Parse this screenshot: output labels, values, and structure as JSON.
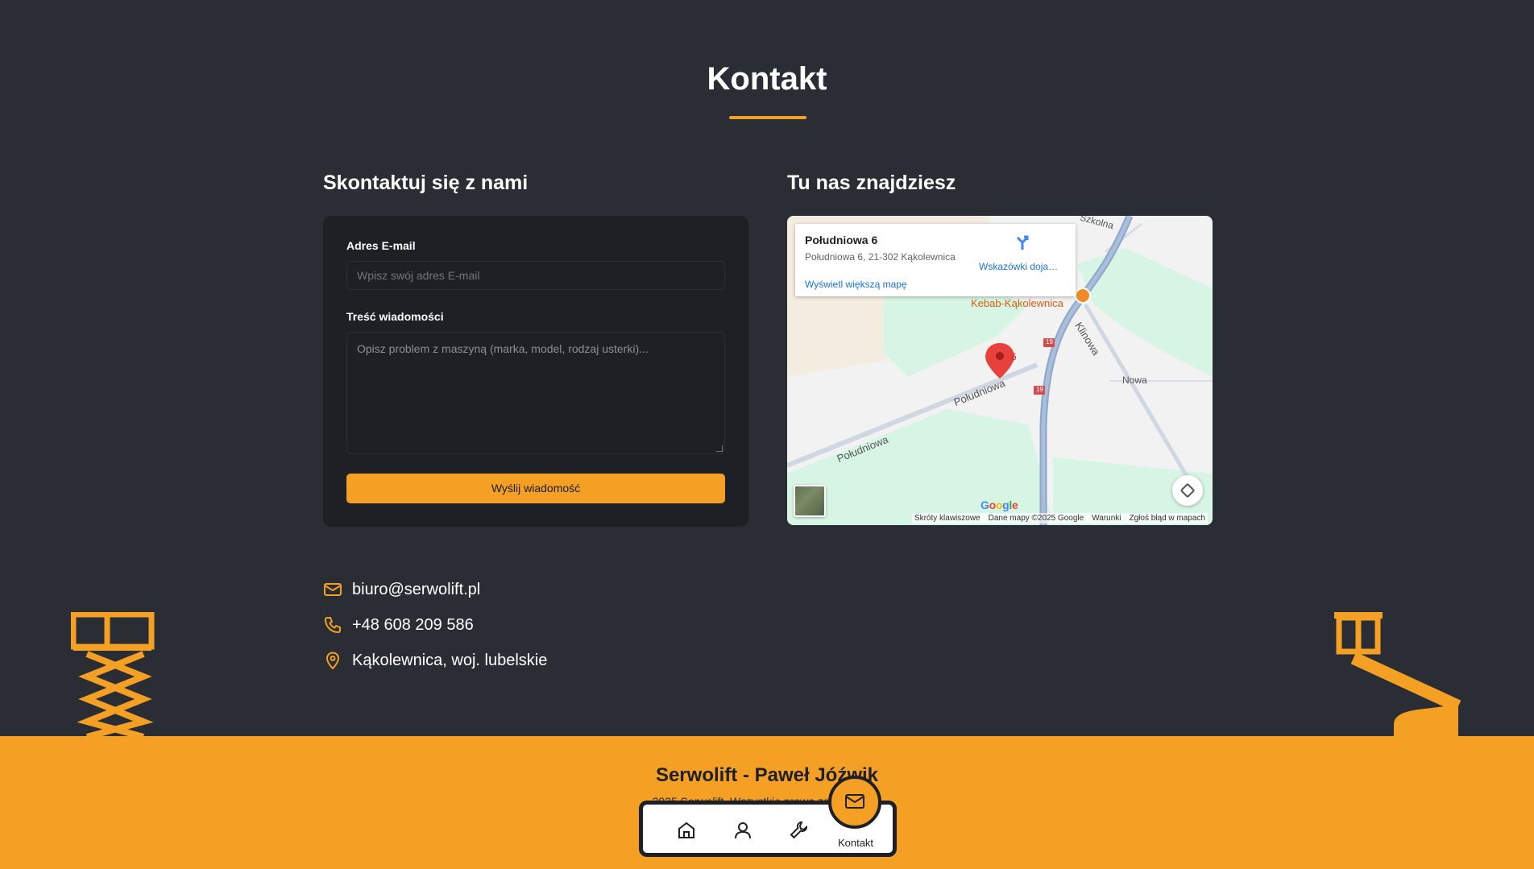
{
  "section": {
    "title": "Kontakt"
  },
  "contact_form": {
    "heading": "Skontaktuj się z nami",
    "email_label": "Adres E-mail",
    "email_placeholder": "Wpisz swój adres E-mail",
    "email_value": "",
    "message_label": "Treść wiadomości",
    "message_placeholder": "Opisz problem z maszyną (marka, model, rodzaj usterki)...",
    "message_value": "",
    "submit_label": "Wyślij wiadomość"
  },
  "map": {
    "heading": "Tu nas znajdziesz",
    "place_name": "Południowa 6",
    "place_address": "Południowa 6, 21-302 Kąkolewnica",
    "directions_label": "Wskazówki doja…",
    "larger_map_label": "Wyświetl większą mapę",
    "labels": {
      "szkolna": "Szkolna",
      "kebab": "Kebab-Kąkolewnica",
      "klinowa": "Klinowa",
      "nowa": "Nowa",
      "poludniowa_1": "Południowa",
      "poludniowa_2": "Południowa",
      "marker_number": "6",
      "road_19a": "19",
      "road_19b": "19"
    },
    "google_logo": "Google",
    "footer": {
      "shortcuts": "Skróty klawiszowe",
      "map_data": "Dane mapy ©2025 Google",
      "terms": "Warunki",
      "report": "Zgłoś błąd w mapach"
    }
  },
  "contact_info": {
    "email": "biuro@serwolift.pl",
    "phone": "+48 608 209 586",
    "location": "Kąkolewnica, woj. lubelskie"
  },
  "footer": {
    "title": "Serwolift - Paweł Jóźwik",
    "subtitle": "2025 Serwolift. Wszystkie prawa zastrzeżone."
  },
  "bottom_nav": {
    "active_label": "Kontakt",
    "items": [
      "home-icon",
      "user-icon",
      "wrench-icon",
      "mail-icon"
    ]
  },
  "colors": {
    "accent": "#f4a024",
    "background": "#2b2d35",
    "card": "#1f2025"
  }
}
